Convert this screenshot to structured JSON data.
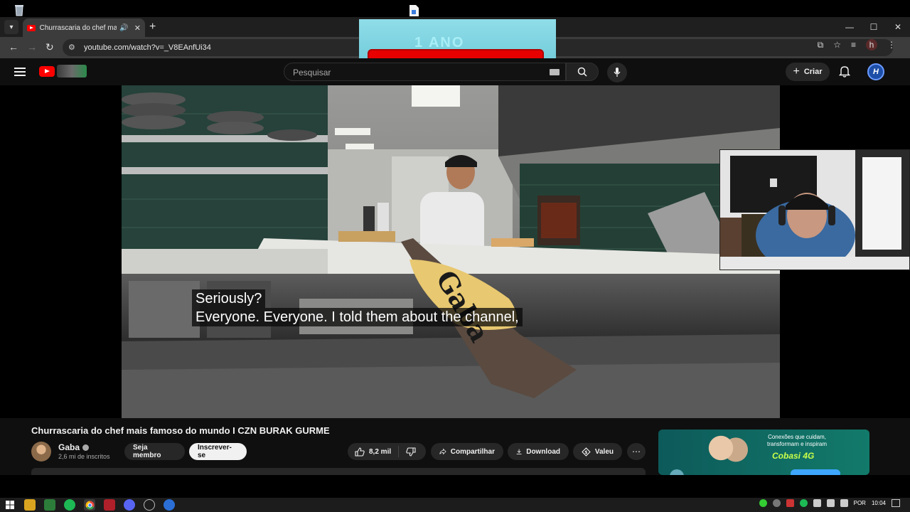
{
  "browser": {
    "tab_title": "Churrascaria do chef mais f",
    "url": "youtube.com/watch?v=_V8EAnfUi34"
  },
  "overlay": {
    "banner_text": "1 ANO"
  },
  "youtube": {
    "search_placeholder": "Pesquisar",
    "create_label": "Criar",
    "avatar_letter": "H",
    "video": {
      "subtitle_line1": "Seriously?",
      "subtitle_line2": "Everyone. Everyone. I told them about the channel,",
      "peel_text": "Gaba"
    },
    "title": "Churrascaria do chef mais famoso do mundo I CZN BURAK GURME",
    "channel": {
      "name": "Gaba",
      "subscribers": "2,6 mi de inscritos"
    },
    "buttons": {
      "member": "Seja membro",
      "subscribe": "Inscrever-se",
      "likes": "8,2 mil",
      "share": "Compartilhar",
      "download": "Download",
      "thanks": "Valeu"
    },
    "ad": {
      "line1": "Conexões que cuidam,",
      "line2": "transformam e inspiram",
      "brand": "Cobasi 4G"
    }
  },
  "taskbar": {
    "language": "POR",
    "time": "10:04"
  },
  "colors": {
    "youtube_red": "#ff0000",
    "banner_red": "#e60000",
    "banner_cyan": "#8fdde9",
    "subscribe_bg": "#f1f1f1"
  }
}
